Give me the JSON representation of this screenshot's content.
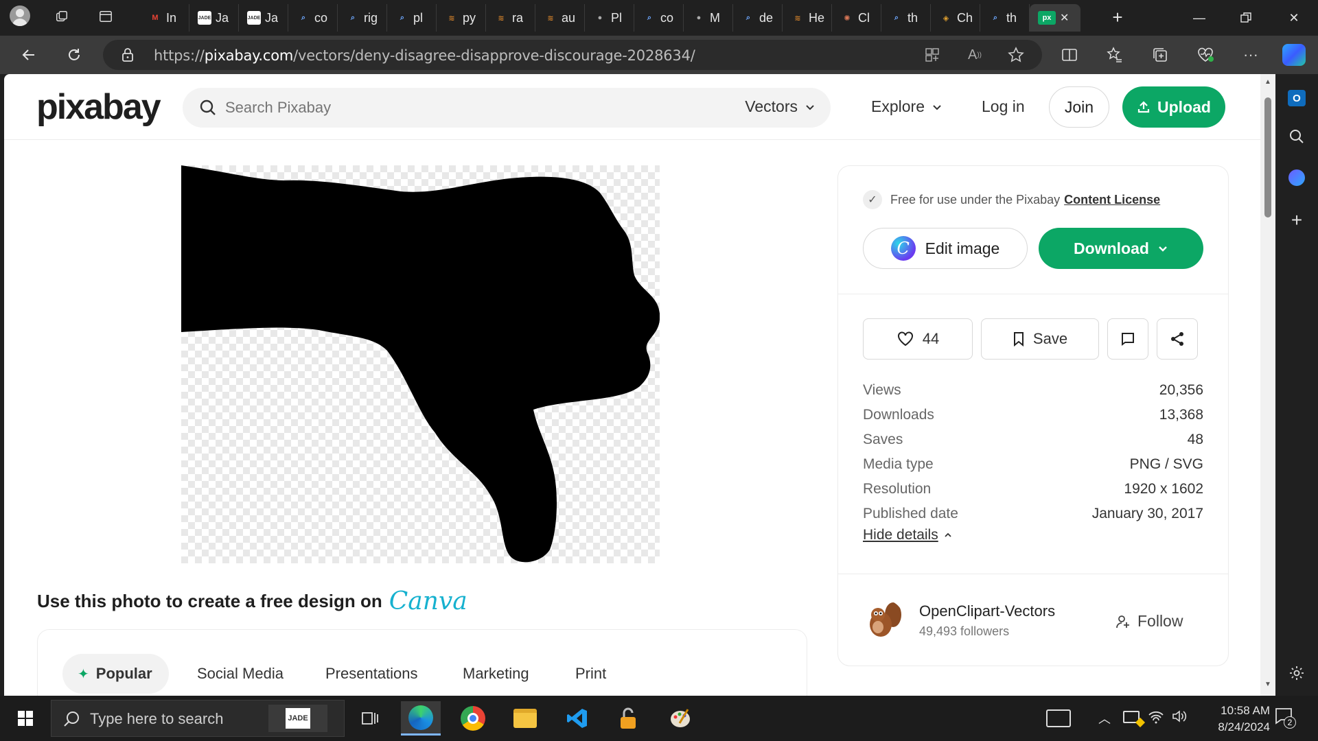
{
  "browser": {
    "tabs": [
      {
        "label": "In",
        "icon": "gmail-icon",
        "color": "#ea4335"
      },
      {
        "label": "Ja",
        "icon": "jade-icon",
        "color": "#ffffff"
      },
      {
        "label": "Ja",
        "icon": "jade-icon",
        "color": "#ffffff"
      },
      {
        "label": "co",
        "icon": "search-icon",
        "color": "#6ea8ff"
      },
      {
        "label": "rig",
        "icon": "search-icon",
        "color": "#6ea8ff"
      },
      {
        "label": "pl",
        "icon": "search-icon",
        "color": "#6ea8ff"
      },
      {
        "label": "py",
        "icon": "stack-icon",
        "color": "#c77b2a"
      },
      {
        "label": "ra",
        "icon": "stack-icon",
        "color": "#c77b2a"
      },
      {
        "label": "au",
        "icon": "stack-icon",
        "color": "#c77b2a"
      },
      {
        "label": "Pl",
        "icon": "python-icon",
        "color": "#aaaaaa"
      },
      {
        "label": "co",
        "icon": "search-icon",
        "color": "#6ea8ff"
      },
      {
        "label": "M",
        "icon": "cloud-icon",
        "color": "#aaaaaa"
      },
      {
        "label": "de",
        "icon": "search-icon",
        "color": "#6ea8ff"
      },
      {
        "label": "He",
        "icon": "stack-icon",
        "color": "#c77b2a"
      },
      {
        "label": "Cl",
        "icon": "claude-icon",
        "color": "#d97757"
      },
      {
        "label": "th",
        "icon": "search-icon",
        "color": "#6ea8ff"
      },
      {
        "label": "Ch",
        "icon": "layers-icon",
        "color": "#e0a030"
      },
      {
        "label": "th",
        "icon": "search-icon",
        "color": "#6ea8ff"
      }
    ],
    "active_tab": {
      "label": "px",
      "icon": "pixabay-icon"
    },
    "url_prefix": "https://",
    "url_domain": "pixabay.com",
    "url_path": "/vectors/deny-disagree-disapprove-discourage-2028634/"
  },
  "header": {
    "logo": "pixabay",
    "search_placeholder": "Search Pixabay",
    "filter_label": "Vectors",
    "explore_label": "Explore",
    "login_label": "Log in",
    "join_label": "Join",
    "upload_label": "Upload"
  },
  "canva": {
    "prompt": "Use this photo to create a free design on",
    "brand": "Canva",
    "tabs": [
      "Popular",
      "Social Media",
      "Presentations",
      "Marketing",
      "Print"
    ]
  },
  "panel": {
    "license_text": "Free for use under the Pixabay",
    "license_link": "Content License",
    "edit_label": "Edit image",
    "download_label": "Download",
    "likes": "44",
    "save_label": "Save",
    "stats": [
      {
        "label": "Views",
        "value": "20,356"
      },
      {
        "label": "Downloads",
        "value": "13,368"
      },
      {
        "label": "Saves",
        "value": "48"
      },
      {
        "label": "Media type",
        "value": "PNG / SVG"
      },
      {
        "label": "Resolution",
        "value": "1920 x 1602"
      },
      {
        "label": "Published date",
        "value": "January 30, 2017"
      }
    ],
    "hide_details": "Hide details",
    "author_name": "OpenClipart-Vectors",
    "author_followers": "49,493 followers",
    "follow_label": "Follow"
  },
  "taskbar": {
    "search_placeholder": "Type here to search",
    "time": "10:58 AM",
    "date": "8/24/2024",
    "notifications": "2"
  },
  "colors": {
    "brand_green": "#0ca765",
    "canva_teal": "#16b1cf"
  }
}
